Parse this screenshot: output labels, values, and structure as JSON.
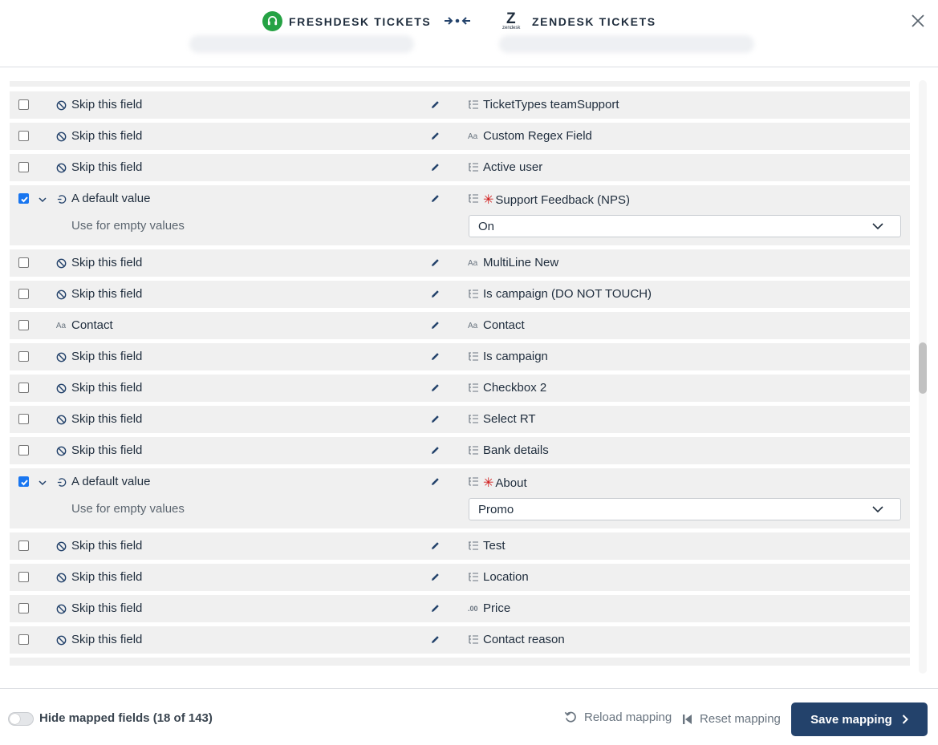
{
  "header": {
    "source": {
      "name": "FRESHDESK TICKETS",
      "logo": "freshdesk-headset-logo",
      "color": "#25a244"
    },
    "target": {
      "name": "ZENDESK TICKETS",
      "logo": "zendesk-logo",
      "logo_text": "zendesk"
    },
    "close_icon": "close-icon"
  },
  "rows": [
    {
      "checked": false,
      "source_icon": "skip-icon",
      "source": "Skip this field",
      "target_icon": "list-icon",
      "target": "TicketTypes teamSupport",
      "required": false
    },
    {
      "checked": false,
      "source_icon": "skip-icon",
      "source": "Skip this field",
      "target_icon": "text-icon",
      "target": "Custom Regex Field",
      "required": false
    },
    {
      "checked": false,
      "source_icon": "skip-icon",
      "source": "Skip this field",
      "target_icon": "list-icon",
      "target": "Active user",
      "required": false
    },
    {
      "checked": true,
      "expanded": true,
      "source_icon": "default-value-icon",
      "source": "A default value",
      "target_icon": "list-icon",
      "target": "Support Feedback (NPS)",
      "required": true,
      "sub_label": "Use for empty values",
      "select_value": "On"
    },
    {
      "checked": false,
      "source_icon": "skip-icon",
      "source": "Skip this field",
      "target_icon": "text-icon",
      "target": "MultiLine New",
      "required": false
    },
    {
      "checked": false,
      "source_icon": "skip-icon",
      "source": "Skip this field",
      "target_icon": "list-icon",
      "target": "Is campaign (DO NOT TOUCH)",
      "required": false
    },
    {
      "checked": false,
      "source_icon": "text-icon",
      "source": "Contact",
      "target_icon": "text-icon",
      "target": "Contact",
      "required": false
    },
    {
      "checked": false,
      "source_icon": "skip-icon",
      "source": "Skip this field",
      "target_icon": "list-icon",
      "target": "Is campaign",
      "required": false
    },
    {
      "checked": false,
      "source_icon": "skip-icon",
      "source": "Skip this field",
      "target_icon": "list-icon",
      "target": "Checkbox 2",
      "required": false
    },
    {
      "checked": false,
      "source_icon": "skip-icon",
      "source": "Skip this field",
      "target_icon": "list-icon",
      "target": "Select RT",
      "required": false
    },
    {
      "checked": false,
      "source_icon": "skip-icon",
      "source": "Skip this field",
      "target_icon": "list-icon",
      "target": "Bank details",
      "required": false
    },
    {
      "checked": true,
      "expanded": true,
      "source_icon": "default-value-icon",
      "source": "A default value",
      "target_icon": "list-icon",
      "target": "About",
      "required": true,
      "sub_label": "Use for empty values",
      "select_value": "Promo"
    },
    {
      "checked": false,
      "source_icon": "skip-icon",
      "source": "Skip this field",
      "target_icon": "list-icon",
      "target": "Test",
      "required": false
    },
    {
      "checked": false,
      "source_icon": "skip-icon",
      "source": "Skip this field",
      "target_icon": "list-icon",
      "target": "Location",
      "required": false
    },
    {
      "checked": false,
      "source_icon": "skip-icon",
      "source": "Skip this field",
      "target_icon": "decimal-icon",
      "target": "Price",
      "required": false
    },
    {
      "checked": false,
      "source_icon": "skip-icon",
      "source": "Skip this field",
      "target_icon": "list-icon",
      "target": "Contact reason",
      "required": false
    }
  ],
  "icon_glyphs": {
    "text_icon": "Aa",
    "decimal_icon": ".00",
    "required_mark": "✳"
  },
  "footer": {
    "toggle_label": "Hide mapped fields (18 of 143)",
    "toggle_on": false,
    "reload_label": "Reload mapping",
    "reset_label": "Reset mapping",
    "save_label": "Save mapping"
  },
  "colors": {
    "accent": "#23426b",
    "checkbox": "#1976f0",
    "required": "#d01a1a",
    "row_bg": "#f0f0f0"
  }
}
